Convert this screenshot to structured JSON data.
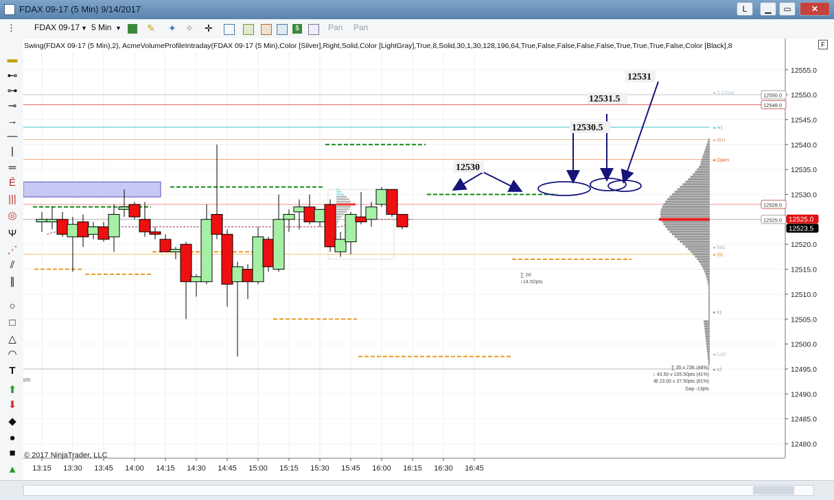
{
  "window": {
    "title": "FDAX 09-17 (5 Min)  9/14/2017",
    "buttons": [
      "L",
      "▁",
      "▭",
      "✕"
    ]
  },
  "toolbar": {
    "instrument": "FDAX 09-17",
    "interval": "5 Min",
    "pan1": "Pan",
    "pan2": "Pan"
  },
  "indicator_label": "Swing(FDAX 09-17 (5 Min),2), AcmeVolumeProfileIntraday(FDAX 09-17 (5 Min),Color [Silver],Right,Solid,Color [LightGray],True,8,Solid,30,1,30,128,196,64,True,False,False,False,False,True,True,True,False,Color [Black],8",
  "corner_label": "F",
  "copyright": "© 2017 NinjaTrader, LLC",
  "left_edge_text": "pts",
  "stats": {
    "box_sigma": "∑ 2K",
    "box_range": "↕14.50pts",
    "line1": "∑ 35 v 73K (48%)",
    "line2": "↕ 43.50 v 105.50pts (41%)",
    "line3": "IB 23.00 v 37.50pts (61%)",
    "line4": "Gap -13pts"
  },
  "level_tags": [
    {
      "name": "S.Close",
      "price": 12550.5,
      "color": "#b0c4d8"
    },
    {
      "name": "H1",
      "price": 12543.5,
      "color": "#48c6c6"
    },
    {
      "name": "IBH",
      "price": 12541.0,
      "color": "#d8a070"
    },
    {
      "name": "Open",
      "price": 12537.0,
      "color": "#e06020"
    },
    {
      "name": "Mid",
      "price": 12519.5,
      "color": "#b8b8b8"
    },
    {
      "name": "IBL",
      "price": 12518.0,
      "color": "#e0a040"
    },
    {
      "name": "x1",
      "price": 12506.5,
      "color": "#909090"
    },
    {
      "name": "LoD",
      "price": 12498.0,
      "color": "#b8b8b8"
    },
    {
      "name": "x2",
      "price": 12495.0,
      "color": "#909090"
    }
  ],
  "chart_data": {
    "type": "candlestick",
    "x_ticks": [
      "13:15",
      "13:30",
      "13:45",
      "14:00",
      "14:15",
      "14:30",
      "14:45",
      "15:00",
      "15:15",
      "15:30",
      "15:45",
      "16:00",
      "16:15",
      "16:30",
      "16:45"
    ],
    "y_ticks": [
      12480.0,
      12485.0,
      12490.0,
      12495.0,
      12500.0,
      12505.0,
      12510.0,
      12515.0,
      12520.0,
      12525.0,
      12530.0,
      12535.0,
      12540.0,
      12545.0,
      12550.0,
      12555.0
    ],
    "ylim": [
      12478.0,
      12558.0
    ],
    "candles": [
      {
        "t": "13:15",
        "open": 12524.5,
        "high": 12526.5,
        "low": 12522.5,
        "close": 12525.0
      },
      {
        "t": "13:20",
        "open": 12524.5,
        "high": 12527.5,
        "low": 12523.0,
        "close": 12525.0
      },
      {
        "t": "13:25",
        "open": 12525.0,
        "high": 12526.5,
        "low": 12521.5,
        "close": 12522.0
      },
      {
        "t": "13:30",
        "open": 12521.5,
        "high": 12525.5,
        "low": 12514.5,
        "close": 12524.0
      },
      {
        "t": "13:35",
        "open": 12524.5,
        "high": 12526.0,
        "low": 12519.5,
        "close": 12521.5
      },
      {
        "t": "13:40",
        "open": 12522.0,
        "high": 12524.5,
        "low": 12521.0,
        "close": 12523.5
      },
      {
        "t": "13:45",
        "open": 12523.5,
        "high": 12524.5,
        "low": 12520.5,
        "close": 12521.0
      },
      {
        "t": "13:50",
        "open": 12521.5,
        "high": 12528.0,
        "low": 12518.5,
        "close": 12526.0
      },
      {
        "t": "13:55",
        "open": 12527.0,
        "high": 12531.0,
        "low": 12525.5,
        "close": 12527.5
      },
      {
        "t": "14:00",
        "open": 12528.0,
        "high": 12528.5,
        "low": 12525.0,
        "close": 12525.5
      },
      {
        "t": "14:05",
        "open": 12525.0,
        "high": 12528.5,
        "low": 12521.5,
        "close": 12522.5
      },
      {
        "t": "14:10",
        "open": 12522.5,
        "high": 12523.5,
        "low": 12521.0,
        "close": 12522.0
      },
      {
        "t": "14:15",
        "open": 12521.0,
        "high": 12522.0,
        "low": 12518.5,
        "close": 12518.5
      },
      {
        "t": "14:20",
        "open": 12518.5,
        "high": 12519.5,
        "low": 12517.0,
        "close": 12519.0
      },
      {
        "t": "14:25",
        "open": 12520.0,
        "high": 12520.5,
        "low": 12505.0,
        "close": 12512.5
      },
      {
        "t": "14:30",
        "open": 12512.5,
        "high": 12514.0,
        "low": 12509.5,
        "close": 12513.5
      },
      {
        "t": "14:35",
        "open": 12512.5,
        "high": 12528.0,
        "low": 12512.0,
        "close": 12525.0
      },
      {
        "t": "14:40",
        "open": 12526.0,
        "high": 12540.0,
        "low": 12521.0,
        "close": 12522.0
      },
      {
        "t": "14:45",
        "open": 12522.0,
        "high": 12523.0,
        "low": 12507.5,
        "close": 12512.0
      },
      {
        "t": "14:50",
        "open": 12512.5,
        "high": 12516.5,
        "low": 12497.5,
        "close": 12515.5
      },
      {
        "t": "14:55",
        "open": 12515.0,
        "high": 12516.0,
        "low": 12509.0,
        "close": 12512.5
      },
      {
        "t": "15:00",
        "open": 12512.5,
        "high": 12523.5,
        "low": 12512.0,
        "close": 12521.5
      },
      {
        "t": "15:05",
        "open": 12521.0,
        "high": 12521.5,
        "low": 12514.5,
        "close": 12515.5
      },
      {
        "t": "15:10",
        "open": 12515.0,
        "high": 12530.0,
        "low": 12514.5,
        "close": 12525.0
      },
      {
        "t": "15:15",
        "open": 12525.0,
        "high": 12527.0,
        "low": 12522.5,
        "close": 12526.0
      },
      {
        "t": "15:20",
        "open": 12526.5,
        "high": 12529.0,
        "low": 12523.0,
        "close": 12527.5
      },
      {
        "t": "15:25",
        "open": 12527.5,
        "high": 12530.0,
        "low": 12524.0,
        "close": 12524.5
      },
      {
        "t": "15:30",
        "open": 12524.5,
        "high": 12527.0,
        "low": 12523.5,
        "close": 12527.0
      },
      {
        "t": "15:35",
        "open": 12528.0,
        "high": 12529.0,
        "low": 12518.5,
        "close": 12519.5
      },
      {
        "t": "15:40",
        "open": 12518.5,
        "high": 12522.5,
        "low": 12517.5,
        "close": 12521.0
      },
      {
        "t": "15:45",
        "open": 12520.5,
        "high": 12526.5,
        "low": 12518.0,
        "close": 12526.0
      },
      {
        "t": "15:50",
        "open": 12525.5,
        "high": 12530.5,
        "low": 12524.0,
        "close": 12524.5
      },
      {
        "t": "15:55",
        "open": 12525.0,
        "high": 12528.5,
        "low": 12523.5,
        "close": 12527.5
      },
      {
        "t": "16:00",
        "open": 12528.0,
        "high": 12531.5,
        "low": 12527.5,
        "close": 12531.0
      },
      {
        "t": "16:05",
        "open": 12531.0,
        "high": 12531.0,
        "low": 12525.5,
        "close": 12526.0
      },
      {
        "t": "16:10",
        "open": 12526.0,
        "high": 12526.0,
        "low": 12523.0,
        "close": 12523.5
      }
    ],
    "price_tags": [
      {
        "value": "12550.0",
        "price": 12550.0,
        "style": "silver"
      },
      {
        "value": "12548.0",
        "price": 12548.0,
        "style": "red"
      },
      {
        "value": "12528.0",
        "price": 12528.0,
        "style": "red"
      },
      {
        "value": "12525.0",
        "price": 12525.0,
        "style": "silver"
      },
      {
        "value": "12525.0",
        "price": 12525.0,
        "style": "current-red"
      },
      {
        "value": "12523.5",
        "price": 12523.5,
        "style": "current-black"
      }
    ],
    "annotations": [
      {
        "text": "12530",
        "price": 12530.0
      },
      {
        "text": "12530.5",
        "price": 12530.5
      },
      {
        "text": "12531.5",
        "price": 12531.5
      },
      {
        "text": "12531",
        "price": 12531.0
      }
    ]
  }
}
